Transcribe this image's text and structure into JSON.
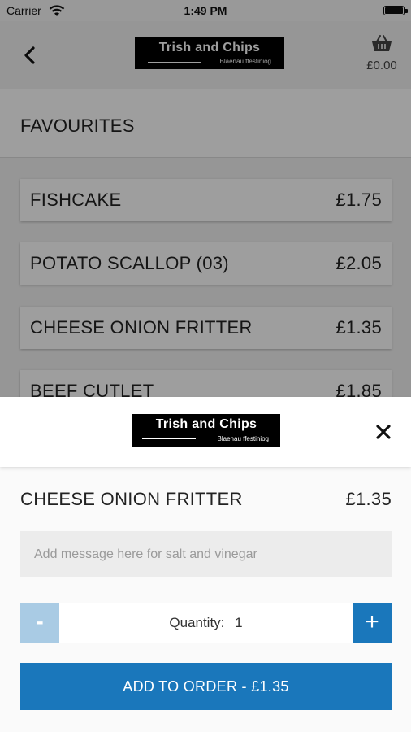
{
  "status_bar": {
    "carrier": "Carrier",
    "time": "1:49 PM"
  },
  "header": {
    "logo_title": "Trish and Chips",
    "logo_subtitle": "Blaenau ffestiniog",
    "basket_total": "£0.00"
  },
  "section": {
    "title": "FAVOURITES"
  },
  "items": [
    {
      "name": "FISHCAKE",
      "price": "£1.75"
    },
    {
      "name": "POTATO SCALLOP (03)",
      "price": "£2.05"
    },
    {
      "name": "CHEESE ONION FRITTER",
      "price": "£1.35"
    },
    {
      "name": "BEEF CUTLET",
      "price": "£1.85"
    }
  ],
  "sheet": {
    "logo_title": "Trish and Chips",
    "logo_subtitle": "Blaenau ffestiniog",
    "product_name": "CHEESE ONION FRITTER",
    "product_price": "£1.35",
    "note_placeholder": "Add message here for salt and vinegar",
    "minus_label": "-",
    "plus_label": "+",
    "quantity_label": "Quantity:",
    "quantity_value": "1",
    "add_button_label": "ADD TO ORDER  -  £1.35"
  },
  "colors": {
    "accent": "#1a77bb",
    "accent_disabled": "#a9cbe4",
    "overlay": "rgba(0,0,0,0.38)"
  },
  "icons": [
    "wifi-icon",
    "battery-icon",
    "back-icon",
    "basket-icon",
    "close-icon"
  ]
}
